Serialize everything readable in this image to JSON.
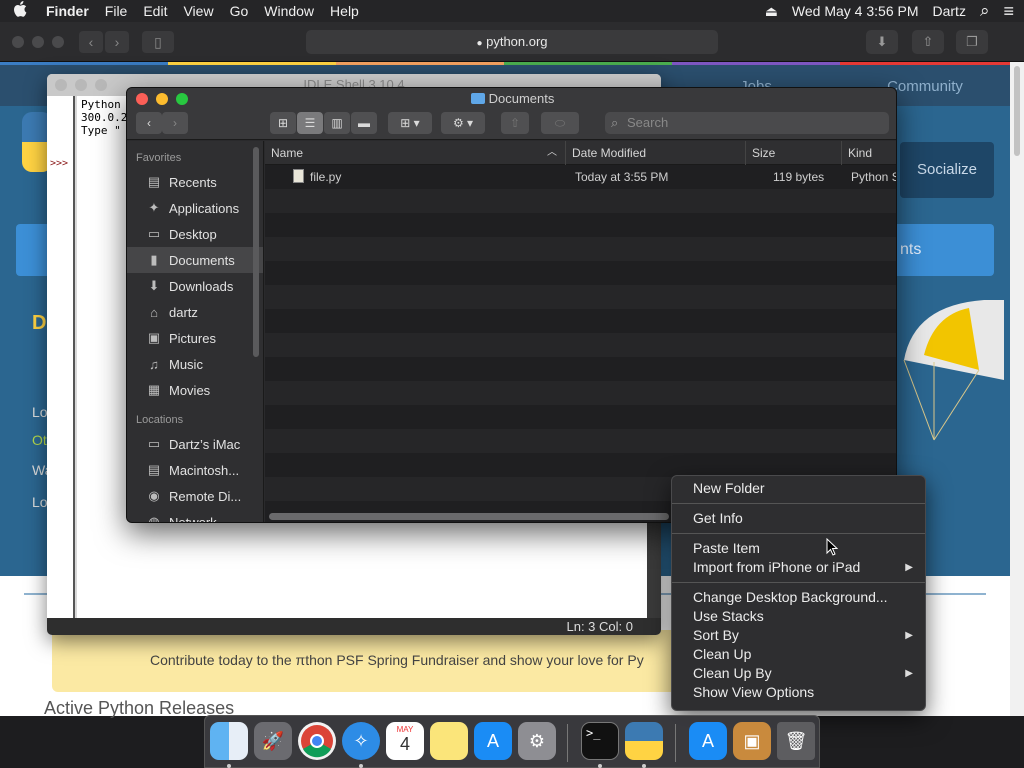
{
  "menubar": {
    "apple": "",
    "app_name": "Finder",
    "items": [
      "File",
      "Edit",
      "View",
      "Go",
      "Window",
      "Help"
    ],
    "eject": "⏏",
    "datetime": "Wed May 4  3:56 PM",
    "user": "Dartz",
    "search_icon": "⌕",
    "list_icon": "≡"
  },
  "safari": {
    "url": "python.org",
    "lock": "🔒",
    "tabs": [
      "Jobs",
      "Community"
    ],
    "socialize": "Socialize",
    "blue_bar_text": "nts",
    "left_snippets": [
      "D",
      "Lo",
      "Ot",
      "Wa",
      "Lo"
    ],
    "donate_text": "Contribute today to the πthon PSF Spring Fundraiser and show your love for Py",
    "releases": "Active Python Releases"
  },
  "idle": {
    "title": "IDLE Shell 3.10.4",
    "lines": [
      "Python",
      "300.0.2",
      "Type \""
    ],
    "prompt": ">>>",
    "status": "Ln: 3   Col: 0"
  },
  "finder": {
    "title": "Documents",
    "search_placeholder": "Search",
    "sidebar": {
      "favorites_label": "Favorites",
      "favorites": [
        {
          "label": "Recents",
          "icon": "▤"
        },
        {
          "label": "Applications",
          "icon": "✦"
        },
        {
          "label": "Desktop",
          "icon": "▭"
        },
        {
          "label": "Documents",
          "icon": "▮"
        },
        {
          "label": "Downloads",
          "icon": "⬇"
        },
        {
          "label": "dartz",
          "icon": "⌂"
        },
        {
          "label": "Pictures",
          "icon": "▣"
        },
        {
          "label": "Music",
          "icon": "♫"
        },
        {
          "label": "Movies",
          "icon": "▦"
        }
      ],
      "locations_label": "Locations",
      "locations": [
        {
          "label": "Dartz’s iMac",
          "icon": "▭"
        },
        {
          "label": "Macintosh...",
          "icon": "▤"
        },
        {
          "label": "Remote Di...",
          "icon": "◉"
        },
        {
          "label": "Network",
          "icon": "◍"
        }
      ]
    },
    "columns": [
      "Name",
      "Date Modified",
      "Size",
      "Kind"
    ],
    "files": [
      {
        "name": "file.py",
        "date": "Today at 3:55 PM",
        "size": "119 bytes",
        "kind": "Python S"
      }
    ]
  },
  "context_menu": {
    "groups": [
      [
        {
          "label": "New Folder"
        }
      ],
      [
        {
          "label": "Get Info"
        }
      ],
      [
        {
          "label": "Paste Item"
        },
        {
          "label": "Import from iPhone or iPad",
          "submenu": true
        }
      ],
      [
        {
          "label": "Change Desktop Background..."
        },
        {
          "label": "Use Stacks"
        },
        {
          "label": "Sort By",
          "submenu": true
        },
        {
          "label": "Clean Up"
        },
        {
          "label": "Clean Up By",
          "submenu": true
        },
        {
          "label": "Show View Options"
        }
      ]
    ]
  },
  "dock": {
    "apps": [
      "Finder",
      "Launchpad",
      "Chrome",
      "Safari",
      "Calendar",
      "Notes",
      "App Store",
      "System Preferences",
      "Terminal",
      "IDLE",
      "App Store Downloads",
      "Archive",
      "Trash"
    ],
    "calendar_month": "MAY",
    "calendar_day": "4"
  },
  "colors": {
    "finder_bg": "#1f1f21",
    "sidebar_selected": "#464648",
    "site_blue": "#2b6690",
    "donate_yellow": "#fbe9a3"
  }
}
